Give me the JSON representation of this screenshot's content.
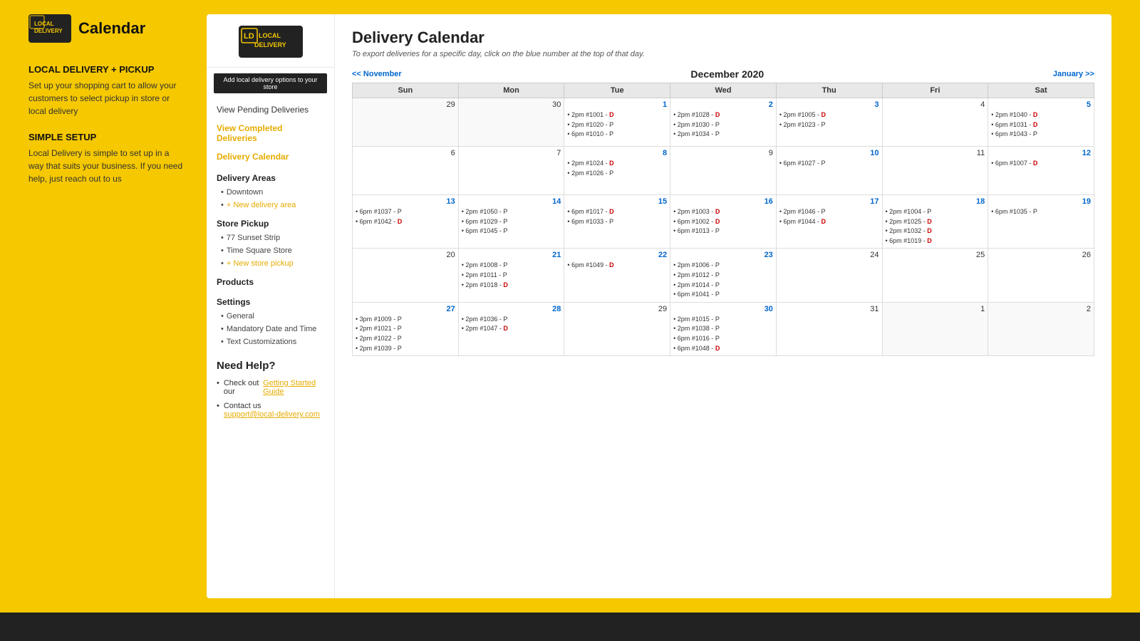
{
  "left": {
    "logo_title": "Calendar",
    "section1_title": "LOCAL DELIVERY + PICKUP",
    "section1_desc": "Set up your shopping cart to allow your customers to select pickup in store or local delivery",
    "section2_title": "SIMPLE SETUP",
    "section2_desc": "Local Delivery is simple to set up in a way that suits your business. If you need help, just reach out to us"
  },
  "sidebar": {
    "add_btn": "Add local delivery options to your store",
    "links": [
      {
        "label": "View Pending Deliveries",
        "active": false
      },
      {
        "label": "View Completed Deliveries",
        "active": false
      },
      {
        "label": "Delivery Calendar",
        "active": true
      }
    ],
    "delivery_areas_title": "Delivery Areas",
    "delivery_areas": [
      {
        "label": "Downtown",
        "add": false
      },
      {
        "label": "+ New delivery area",
        "add": true
      }
    ],
    "store_pickup_title": "Store Pickup",
    "store_pickups": [
      {
        "label": "77 Sunset Strip",
        "add": false
      },
      {
        "label": "Time Square Store",
        "add": false
      },
      {
        "label": "+ New store pickup",
        "add": true
      }
    ],
    "products_title": "Products",
    "settings_title": "Settings",
    "settings_items": [
      {
        "label": "General"
      },
      {
        "label": "Mandatory Date and Time"
      },
      {
        "label": "Text Customizations"
      }
    ]
  },
  "calendar": {
    "title": "Delivery Calendar",
    "subtitle": "To export deliveries for a specific day, click on the blue number at the top of that day.",
    "nav_prev": "<< November",
    "nav_next": "January >>",
    "month_title": "December 2020",
    "headers": [
      "Sun",
      "Mon",
      "Tue",
      "Wed",
      "Thu",
      "Fri",
      "Sat"
    ],
    "weeks": [
      [
        {
          "day": "29",
          "entries": [],
          "prev": true
        },
        {
          "day": "30",
          "entries": [],
          "prev": true
        },
        {
          "day": "1",
          "entries": [
            "• 2pm #1001 - D",
            "• 2pm #1020 - P",
            "• 6pm #1010 - P"
          ],
          "blue": true
        },
        {
          "day": "2",
          "entries": [
            "• 2pm #1028 - D",
            "• 2pm #1030 - P",
            "• 2pm #1034 - P"
          ],
          "blue": true
        },
        {
          "day": "3",
          "entries": [
            "• 2pm #1005 - D",
            "• 2pm #1023 - P"
          ],
          "blue": true
        },
        {
          "day": "4",
          "entries": []
        },
        {
          "day": "5",
          "entries": [
            "• 2pm #1040 - D",
            "• 6pm #1031 - D",
            "• 6pm #1043 - P"
          ],
          "blue": true
        }
      ],
      [
        {
          "day": "6",
          "entries": []
        },
        {
          "day": "7",
          "entries": []
        },
        {
          "day": "8",
          "entries": [
            "• 2pm #1024 - D",
            "• 2pm #1026 - P"
          ],
          "blue": true
        },
        {
          "day": "9",
          "entries": []
        },
        {
          "day": "10",
          "entries": [
            "• 6pm #1027 - P"
          ],
          "blue": true
        },
        {
          "day": "11",
          "entries": []
        },
        {
          "day": "12",
          "entries": [
            "• 6pm #1007 - D"
          ],
          "blue": true
        }
      ],
      [
        {
          "day": "13",
          "entries": [
            "• 6pm #1037 - P",
            "• 6pm #1042 - D"
          ],
          "blue": true
        },
        {
          "day": "14",
          "entries": [
            "• 2pm #1050 - P",
            "• 6pm #1029 - P",
            "• 6pm #1045 - P"
          ],
          "blue": true
        },
        {
          "day": "15",
          "entries": [
            "• 6pm #1017 - D",
            "• 6pm #1033 - P"
          ],
          "blue": true
        },
        {
          "day": "16",
          "entries": [
            "• 2pm #1003 - D",
            "• 6pm #1002 - D",
            "• 6pm #1013 - P"
          ],
          "blue": true
        },
        {
          "day": "17",
          "entries": [
            "• 2pm #1046 - P",
            "• 6pm #1044 - D"
          ],
          "blue": true
        },
        {
          "day": "18",
          "entries": [
            "• 2pm #1004 - P",
            "• 2pm #1025 - D",
            "• 2pm #1032 - D",
            "• 6pm #1019 - D"
          ],
          "blue": true
        },
        {
          "day": "19",
          "entries": [
            "• 6pm #1035 - P"
          ],
          "blue": true
        }
      ],
      [
        {
          "day": "20",
          "entries": []
        },
        {
          "day": "21",
          "entries": [
            "• 2pm #1008 - P",
            "• 2pm #1011 - P",
            "• 2pm #1018 - D"
          ],
          "blue": true
        },
        {
          "day": "22",
          "entries": [
            "• 6pm #1049 - D"
          ],
          "blue": true
        },
        {
          "day": "23",
          "entries": [
            "• 2pm #1006 - P",
            "• 2pm #1012 - P",
            "• 2pm #1014 - P",
            "• 6pm #1041 - P"
          ],
          "blue": true
        },
        {
          "day": "24",
          "entries": []
        },
        {
          "day": "25",
          "entries": []
        },
        {
          "day": "26",
          "entries": []
        }
      ],
      [
        {
          "day": "27",
          "entries": [
            "• 3pm #1009 - P",
            "• 2pm #1021 - P",
            "• 2pm #1022 - P",
            "• 2pm #1039 - P"
          ],
          "blue": true
        },
        {
          "day": "28",
          "entries": [
            "• 2pm #1036 - P",
            "• 2pm #1047 - D"
          ],
          "blue": true
        },
        {
          "day": "29",
          "entries": []
        },
        {
          "day": "30",
          "entries": [
            "• 2pm #1015 - P",
            "• 2pm #1038 - P",
            "• 6pm #1016 - P",
            "• 6pm #1048 - D"
          ],
          "blue": true
        },
        {
          "day": "31",
          "entries": []
        },
        {
          "day": "1",
          "entries": [],
          "next": true
        },
        {
          "day": "2",
          "entries": [],
          "next": true
        }
      ]
    ]
  },
  "need_help": {
    "title": "Need Help?",
    "items": [
      {
        "text": "Check out our ",
        "link": "Getting Started Guide",
        "link_label": "getting-started-guide"
      },
      {
        "text": "Contact us",
        "sub": "support@local-delivery.com"
      }
    ]
  }
}
